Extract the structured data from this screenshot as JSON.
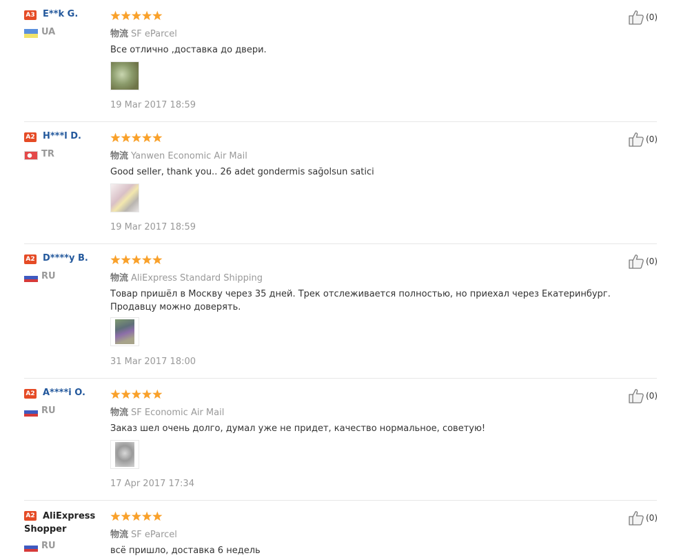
{
  "logistics_label": "物流",
  "reviews": [
    {
      "badge": "A3",
      "name": "E**k G.",
      "country": "UA",
      "flag_colors": [
        "#5a8fdd",
        "#f1e36a"
      ],
      "rating": 5,
      "logistics": "SF eParcel",
      "text": "Все отлично ,доставка до двери.",
      "date": "19 Mar 2017 18:59",
      "helpful_count": "(0)"
    },
    {
      "badge": "A2",
      "name": "H***l D.",
      "country": "TR",
      "flag_colors": [
        "#e44949",
        "#e44949"
      ],
      "rating": 5,
      "logistics": "Yanwen Economic Air Mail",
      "text": "Good seller, thank you.. 26 adet gondermis sağolsun satici",
      "date": "19 Mar 2017 18:59",
      "helpful_count": "(0)"
    },
    {
      "badge": "A2",
      "name": "D****y B.",
      "country": "RU",
      "flag_colors": [
        "#ffffff",
        "#3f5ac0",
        "#d63a3a"
      ],
      "rating": 5,
      "logistics": "AliExpress Standard Shipping",
      "text": "Товар пришёл в Москву через 35 дней. Трек отслеживается полностью, но приехал через Екатеринбург. Продавцу можно доверять.",
      "date": "31 Mar 2017 18:00",
      "helpful_count": "(0)"
    },
    {
      "badge": "A2",
      "name": "A****i O.",
      "country": "RU",
      "flag_colors": [
        "#ffffff",
        "#3f5ac0",
        "#d63a3a"
      ],
      "rating": 5,
      "logistics": "SF Economic Air Mail",
      "text": "Заказ шел очень долго, думал уже не придет, качество нормальное, советую!",
      "date": "17 Apr 2017 17:34",
      "helpful_count": "(0)"
    },
    {
      "badge": "A2",
      "name": "AliExpress Shopper",
      "country": "RU",
      "flag_colors": [
        "#ffffff",
        "#3f5ac0",
        "#d63a3a"
      ],
      "rating": 5,
      "logistics": "SF eParcel",
      "text": "всё пришло, доставка 6 недель",
      "helpful_count": "(0)"
    }
  ],
  "colors": {
    "star": "#f9a12b",
    "badge": "#e54b26",
    "username": "#23589c",
    "muted": "#999999"
  }
}
